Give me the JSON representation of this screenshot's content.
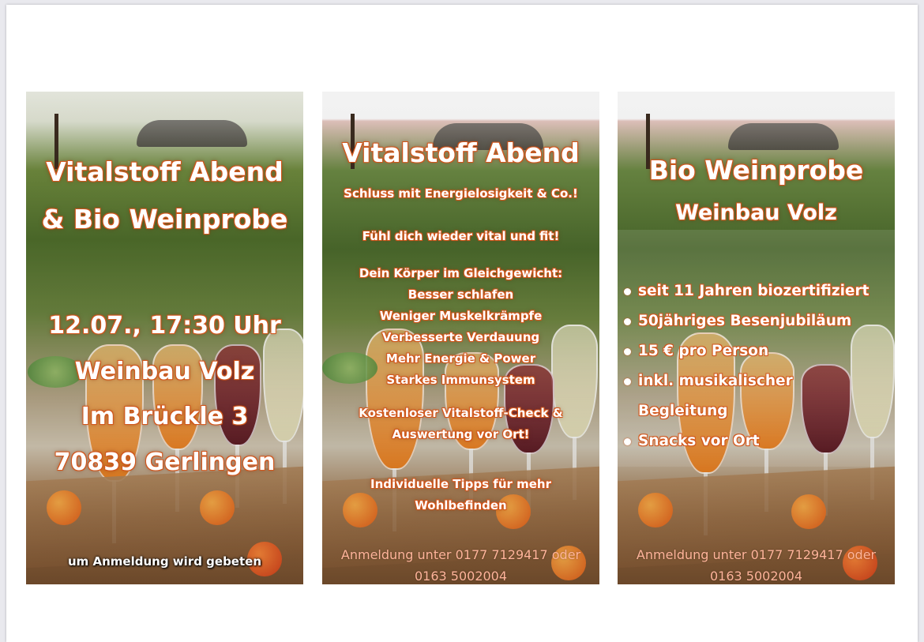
{
  "poster1": {
    "title_lines": [
      "Vitalstoff Abend",
      "& Bio Weinprobe"
    ],
    "info_lines": [
      "12.07., 17:30 Uhr",
      "Weinbau Volz",
      "Im Brückle 3",
      "70839 Gerlingen"
    ],
    "footer": "um Anmeldung wird gebeten"
  },
  "poster2": {
    "title": "Vitalstoff Abend",
    "subtitle": "Schluss mit Energielosigkeit & Co.!",
    "line2": "Fühl dich wieder vital und fit!",
    "balance_lines": [
      "Dein Körper im Gleichgewicht:",
      "Besser schlafen",
      "Weniger Muskelkrämpfe",
      "Verbesserte Verdauung",
      "Mehr Energie & Power",
      "Starkes Immunsystem"
    ],
    "check_lines": [
      "Kostenloser Vitalstoff-Check &",
      "Auswertung vor Ort!"
    ],
    "tips_lines": [
      "Individuelle Tipps für mehr",
      "Wohlbefinden"
    ],
    "footer_lines": [
      "Anmeldung unter 0177 7129417 oder",
      "0163 5002004"
    ]
  },
  "poster3": {
    "title": "Bio Weinprobe",
    "subtitle": "Weinbau Volz",
    "bullets": [
      "seit  11 Jahren biozertifiziert",
      "50jähriges Besenjubiläum",
      "15 € pro Person",
      "inkl. musikalischer",
      "Snacks vor Ort"
    ],
    "bullet_continuation": "Begleitung",
    "footer_lines": [
      "Anmeldung unter 0177 7129417 oder",
      "0163 5002004"
    ]
  },
  "colors": {
    "text_outline": "#d2561c",
    "footer_text": "#ffb49a",
    "page_background": "#ffffff"
  }
}
